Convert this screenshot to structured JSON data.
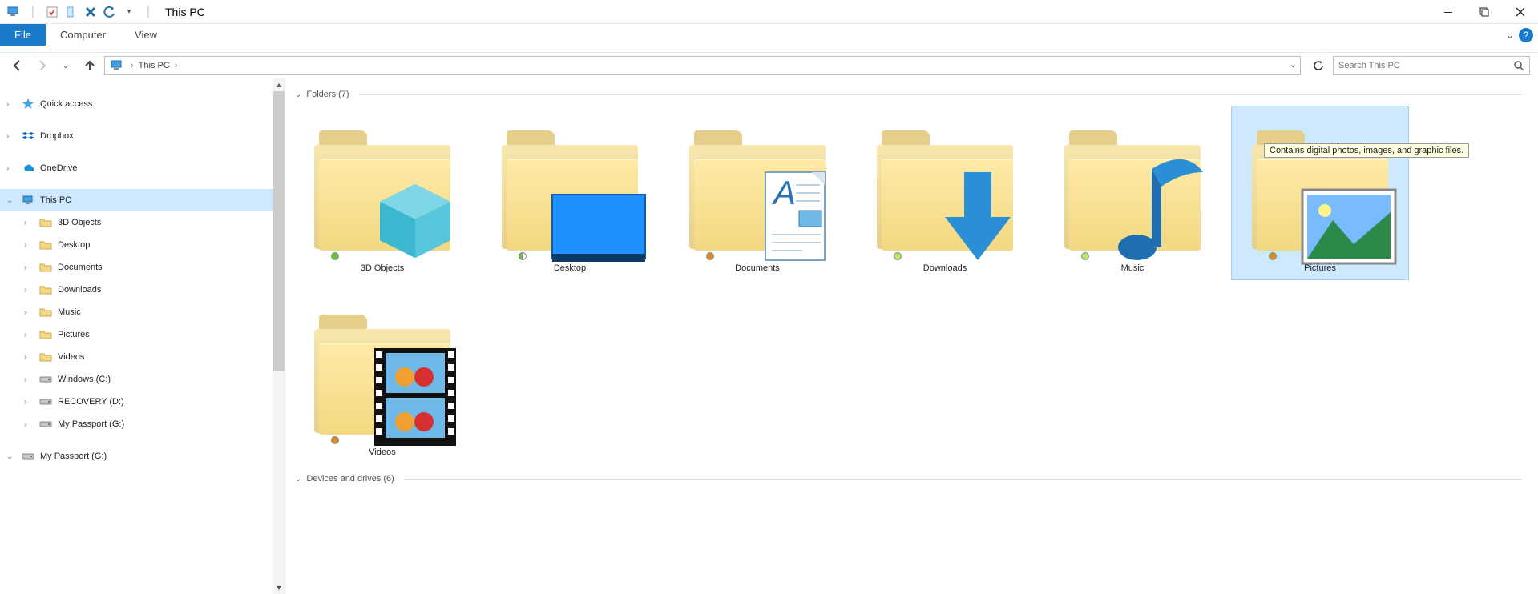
{
  "title": "This PC",
  "ribbon": {
    "file": "File",
    "tabs": [
      "Computer",
      "View"
    ]
  },
  "address": {
    "crumb": "This PC",
    "search_placeholder": "Search This PC"
  },
  "nav_tree": {
    "top": [
      {
        "label": "Quick access",
        "icon": "star"
      },
      {
        "label": "Dropbox",
        "icon": "dropbox"
      },
      {
        "label": "OneDrive",
        "icon": "onedrive"
      }
    ],
    "this_pc": "This PC",
    "this_pc_children": [
      {
        "label": "3D Objects",
        "icon": "folder"
      },
      {
        "label": "Desktop",
        "icon": "folder"
      },
      {
        "label": "Documents",
        "icon": "folder"
      },
      {
        "label": "Downloads",
        "icon": "folder"
      },
      {
        "label": "Music",
        "icon": "folder"
      },
      {
        "label": "Pictures",
        "icon": "folder"
      },
      {
        "label": "Videos",
        "icon": "folder"
      },
      {
        "label": "Windows (C:)",
        "icon": "drive"
      },
      {
        "label": "RECOVERY (D:)",
        "icon": "drive"
      },
      {
        "label": "My Passport (G:)",
        "icon": "drive"
      }
    ],
    "bottom": [
      {
        "label": "My Passport (G:)",
        "icon": "drive"
      }
    ]
  },
  "groups": {
    "folders_header": "Folders (7)",
    "devices_header": "Devices and drives (6)"
  },
  "folders": [
    {
      "label": "3D Objects",
      "overlay": "cube",
      "status": "green"
    },
    {
      "label": "Desktop",
      "overlay": "monitor",
      "status": "half"
    },
    {
      "label": "Documents",
      "overlay": "doc",
      "status": "orange"
    },
    {
      "label": "Downloads",
      "overlay": "arrow",
      "status": "lime"
    },
    {
      "label": "Music",
      "overlay": "note",
      "status": "lime"
    },
    {
      "label": "Pictures",
      "overlay": "photo",
      "status": "orange",
      "selected": true
    },
    {
      "label": "Videos",
      "overlay": "film",
      "status": "orange"
    }
  ],
  "tooltip": "Contains digital photos, images, and graphic files."
}
